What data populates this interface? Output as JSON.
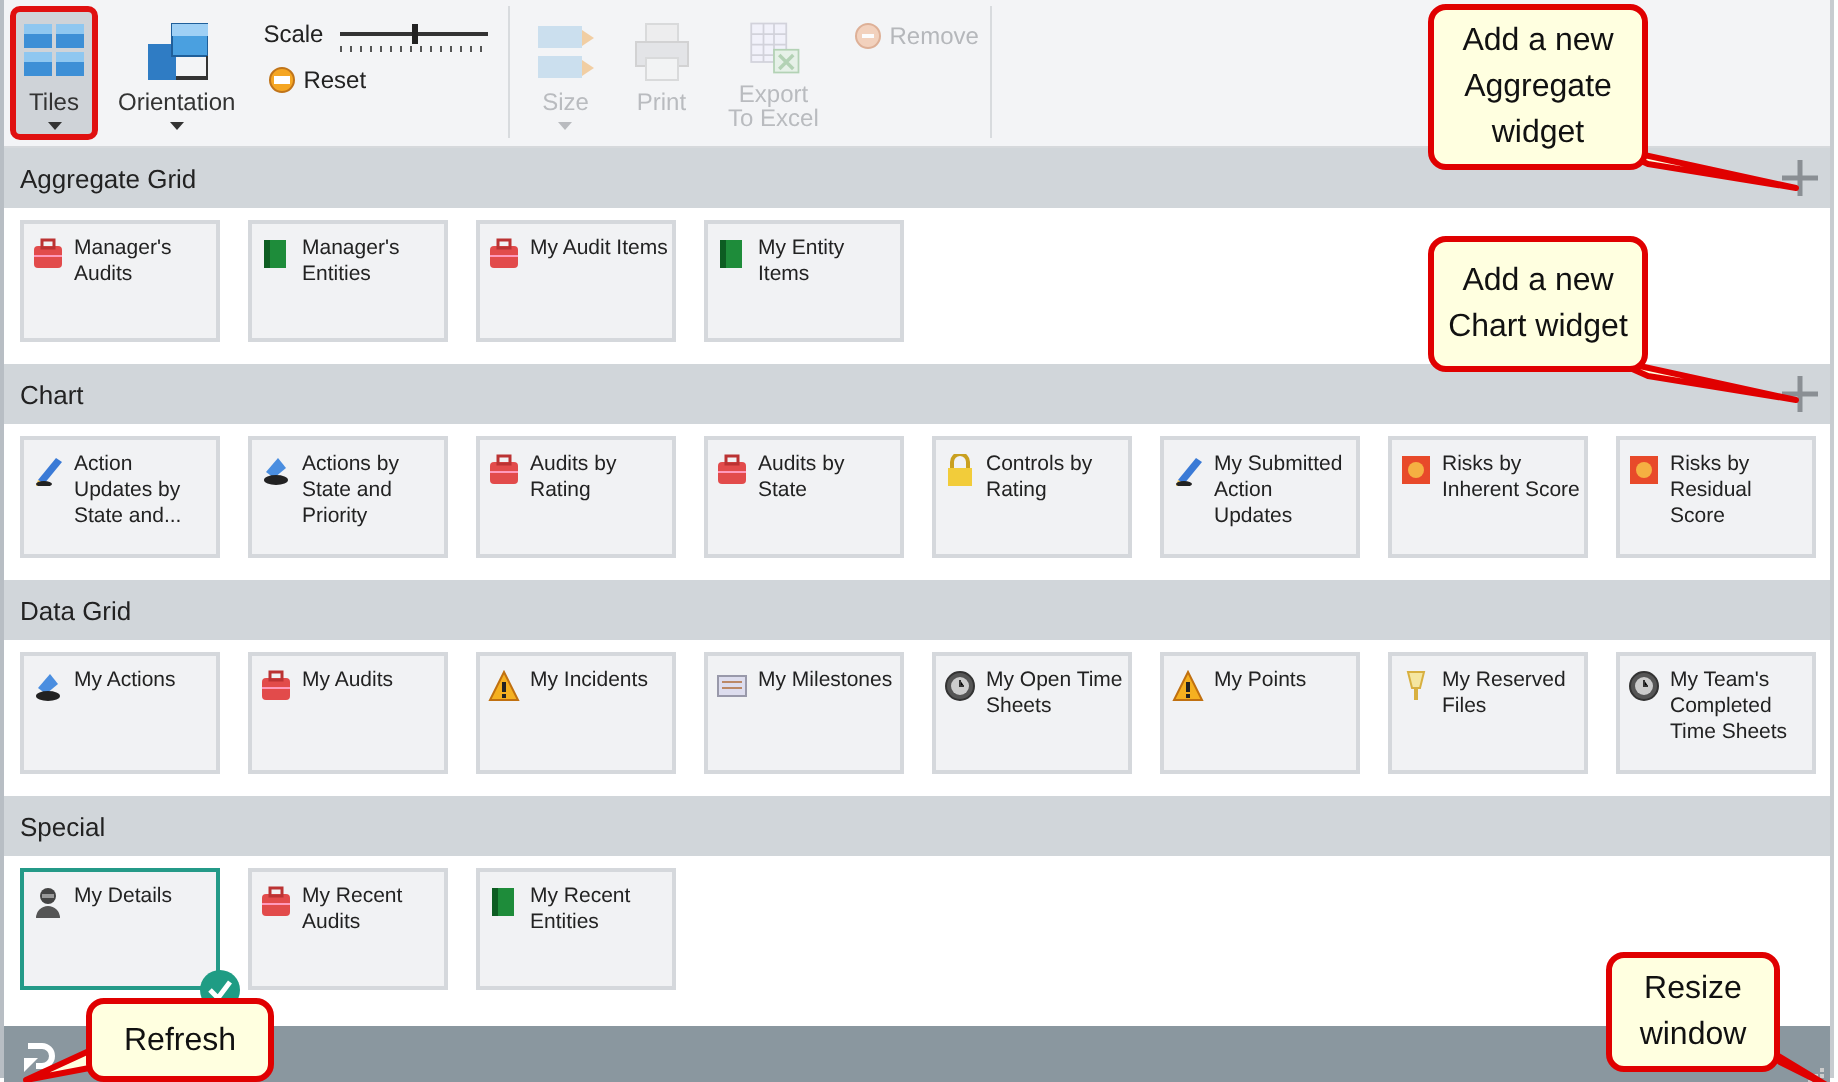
{
  "ribbon": {
    "items": [
      {
        "kind": "large",
        "label": "Tiles",
        "dropdown": true,
        "disabled": false,
        "annotated": true
      },
      {
        "kind": "large",
        "label": "Orientation",
        "dropdown": true,
        "disabled": false,
        "annotated": false
      },
      {
        "kind": "scale",
        "label": "Scale",
        "level": 0.5,
        "button": "Reset"
      },
      {
        "kind": "separator"
      },
      {
        "kind": "large",
        "label": "Size",
        "dropdown": true,
        "disabled": true,
        "annotated": false
      },
      {
        "kind": "large",
        "label": "Print",
        "dropdown": false,
        "disabled": true,
        "annotated": false
      },
      {
        "kind": "large",
        "label": "Export To Excel",
        "dropdown": false,
        "disabled": true,
        "annotated": false
      },
      {
        "kind": "small",
        "label": "Remove",
        "disabled": true
      },
      {
        "kind": "separator"
      }
    ]
  },
  "sections": [
    {
      "title": "Aggregate Grid",
      "can_add": true,
      "callout": "Add a new Aggregate widget",
      "tiles": [
        {
          "kind": "audit",
          "label": "Manager's Audits",
          "selected": false
        },
        {
          "kind": "entity",
          "label": "Manager's Entities",
          "selected": false
        },
        {
          "kind": "audit",
          "label": "My Audit Items",
          "selected": false
        },
        {
          "kind": "entity",
          "label": "My Entity Items",
          "selected": false
        }
      ]
    },
    {
      "title": "Chart",
      "can_add": true,
      "callout": "Add a new Chart widget",
      "tiles": [
        {
          "kind": "pen",
          "label": "Action Updates by State and...",
          "selected": false
        },
        {
          "kind": "action",
          "label": "Actions by State and Priority",
          "selected": false
        },
        {
          "kind": "audit",
          "label": "Audits by Rating",
          "selected": false
        },
        {
          "kind": "audit",
          "label": "Audits by State",
          "selected": false
        },
        {
          "kind": "lock",
          "label": "Controls by Rating",
          "selected": false
        },
        {
          "kind": "pen",
          "label": "My Submitted Action Updates",
          "selected": false
        },
        {
          "kind": "risk",
          "label": "Risks by Inherent Score",
          "selected": false
        },
        {
          "kind": "risk",
          "label": "Risks by Residual Score",
          "selected": false
        }
      ]
    },
    {
      "title": "Data Grid",
      "can_add": false,
      "tiles": [
        {
          "kind": "action",
          "label": "My Actions",
          "selected": false
        },
        {
          "kind": "audit",
          "label": "My Audits",
          "selected": false
        },
        {
          "kind": "warning",
          "label": "My Incidents",
          "selected": false
        },
        {
          "kind": "milestone",
          "label": "My Milestones",
          "selected": false
        },
        {
          "kind": "clock",
          "label": "My Open Time Sheets",
          "selected": false
        },
        {
          "kind": "warning",
          "label": "My Points",
          "selected": false
        },
        {
          "kind": "pin",
          "label": "My Reserved Files",
          "selected": false
        },
        {
          "kind": "clock",
          "label": "My Team's Completed Time Sheets",
          "selected": false
        }
      ]
    },
    {
      "title": "Special",
      "can_add": false,
      "tiles": [
        {
          "kind": "person",
          "label": "My Details",
          "selected": true
        },
        {
          "kind": "audit",
          "label": "My Recent Audits",
          "selected": false
        },
        {
          "kind": "entity",
          "label": "My Recent Entities",
          "selected": false
        }
      ]
    }
  ],
  "footer": {
    "refresh_callout": "Refresh",
    "resize_callout": "Resize window"
  }
}
